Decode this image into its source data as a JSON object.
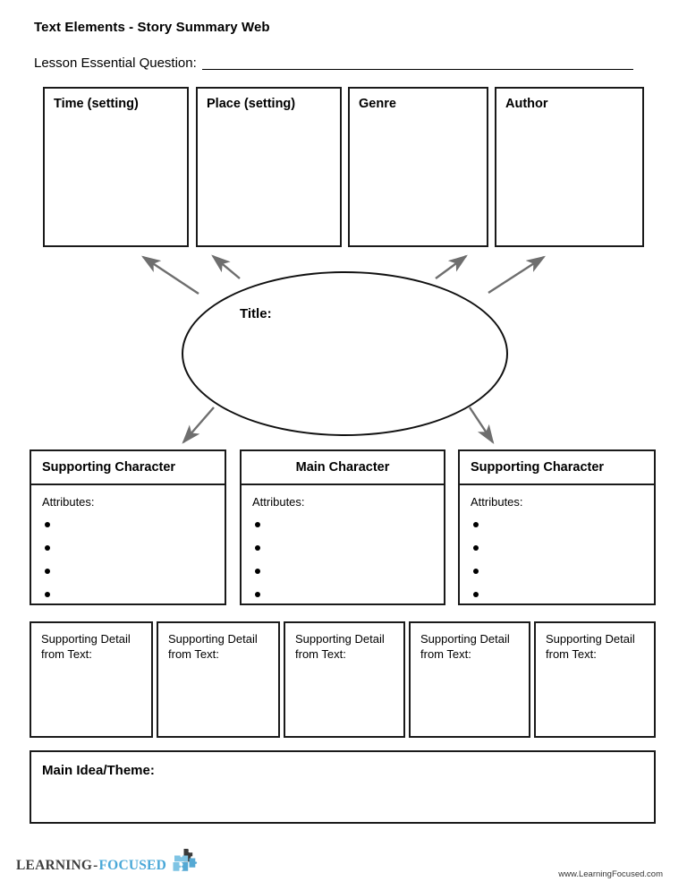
{
  "header": {
    "title": "Text Elements - Story Summary Web",
    "essential_question_label": "Lesson Essential Question:",
    "essential_question_value": ""
  },
  "top_boxes": [
    {
      "label": "Time (setting)",
      "value": ""
    },
    {
      "label": "Place (setting)",
      "value": ""
    },
    {
      "label": "Genre",
      "value": ""
    },
    {
      "label": "Author",
      "value": ""
    }
  ],
  "center": {
    "title_label": "Title:",
    "title_value": ""
  },
  "character_boxes": [
    {
      "header": "Supporting Character",
      "align": "left",
      "attributes_label": "Attributes:",
      "bullets": [
        "",
        "",
        "",
        ""
      ]
    },
    {
      "header": "Main Character",
      "align": "center",
      "attributes_label": "Attributes:",
      "bullets": [
        "",
        "",
        "",
        ""
      ]
    },
    {
      "header": "Supporting Character",
      "align": "left",
      "attributes_label": "Attributes:",
      "bullets": [
        "",
        "",
        "",
        ""
      ]
    }
  ],
  "detail_boxes": [
    {
      "label": "Supporting Detail from Text:",
      "value": ""
    },
    {
      "label": "Supporting Detail from Text:",
      "value": ""
    },
    {
      "label": "Supporting Detail from Text:",
      "value": ""
    },
    {
      "label": "Supporting Detail from Text:",
      "value": ""
    },
    {
      "label": "Supporting Detail from Text:",
      "value": ""
    }
  ],
  "main_idea": {
    "label": "Main Idea/Theme:",
    "value": ""
  },
  "footer": {
    "logo_part1": "LEARNING",
    "logo_dash": "-",
    "logo_part2": "FOCUSED",
    "logo_icon": "puzzle-pieces-icon",
    "url": "www.LearningFocused.com"
  },
  "colors": {
    "border": "#1a1a1a",
    "arrow": "#6e6e6e",
    "logo_dark": "#3f3f3f",
    "logo_blue": "#4aa8d8",
    "puzzle_light": "#7fc4e4",
    "puzzle_mid": "#55a9d4",
    "puzzle_dark": "#3a3a3a"
  }
}
